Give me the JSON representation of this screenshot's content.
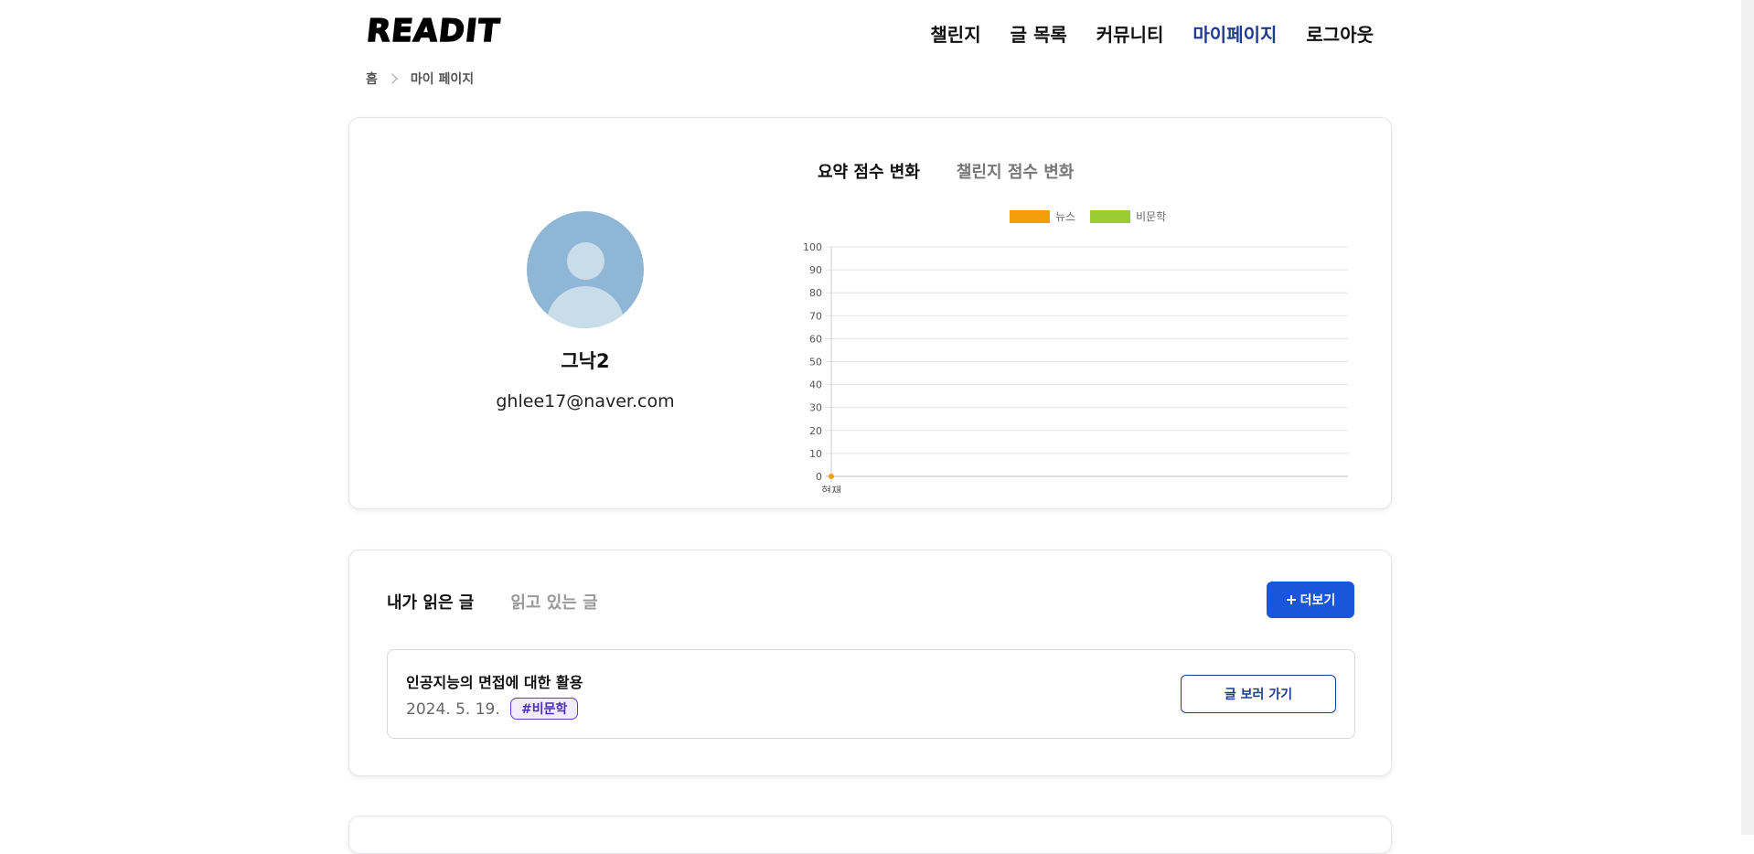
{
  "header": {
    "logo": "READIT",
    "nav": [
      "챌린지",
      "글 목록",
      "커뮤니티",
      "마이페이지",
      "로그아웃"
    ],
    "active": "마이페이지"
  },
  "breadcrumb": {
    "home": "홈",
    "current": "마이 페이지"
  },
  "profile": {
    "nickname": "그낙2",
    "email": "ghlee17@naver.com"
  },
  "chart_tabs": [
    "요약 점수 변화",
    "챌린지 점수 변화"
  ],
  "chart_data": {
    "type": "line",
    "categories": [
      "현재"
    ],
    "series": [
      {
        "name": "뉴스",
        "color": "#f59e0b",
        "values": [
          0
        ]
      },
      {
        "name": "비문학",
        "color": "#9acd32",
        "values": [
          null
        ]
      }
    ],
    "ylim": [
      0,
      100
    ],
    "yticks": [
      "0",
      "10",
      "20",
      "30",
      "40",
      "50",
      "60",
      "70",
      "80",
      "90",
      "100"
    ],
    "grid": true,
    "legend": "top"
  },
  "reading": {
    "tabs": [
      "내가 읽은 글",
      "읽고 있는 글"
    ],
    "more_label": "더보기",
    "more_icon": "plus-icon",
    "items": [
      {
        "title": "인공지능의 면접에 대한 활용",
        "date": "2024. 5. 19.",
        "tag": "#비문학",
        "button": "글 보러 가기"
      }
    ]
  }
}
